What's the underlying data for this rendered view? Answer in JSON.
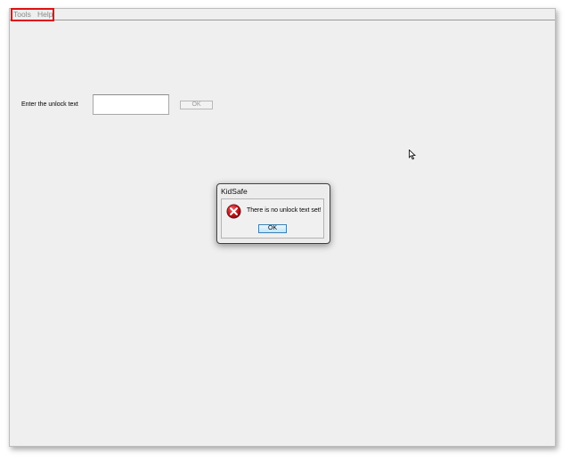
{
  "menu": {
    "items": [
      {
        "label": "Tools"
      },
      {
        "label": "Help"
      }
    ]
  },
  "unlock": {
    "label": "Enter the unlock text",
    "input_value": "",
    "ok_label": "OK"
  },
  "dialog": {
    "title": "KidSafe",
    "icon": "error-icon",
    "message": "There is no unlock text set!",
    "ok_label": "OK"
  },
  "colors": {
    "highlight": "#e01010",
    "window_bg": "#efefef",
    "error_red": "#c0141a"
  }
}
